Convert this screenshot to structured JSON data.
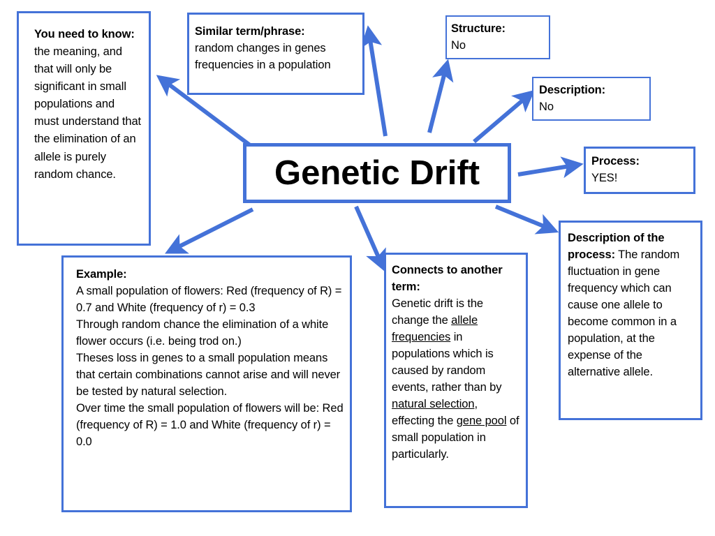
{
  "diagram": {
    "title": "Genetic Drift",
    "type": "concept-map",
    "colors": {
      "border": "#4472D8",
      "arrow": "#4472D8",
      "text": "#000000",
      "background": "#FFFFFF"
    },
    "center": {
      "label": "Genetic Drift"
    },
    "nodes": {
      "need_to_know": {
        "title": "You need to know:",
        "body": " the meaning, and that will only be significant in small populations and must understand that the elimination of an allele is purely random chance."
      },
      "similar_term": {
        "title": "Similar term/phrase:",
        "body": "random changes in genes frequencies in a population"
      },
      "structure": {
        "title": "Structure:",
        "body": "No"
      },
      "description": {
        "title": "Description:",
        "body": "No"
      },
      "process": {
        "title": "Process:",
        "body": "YES!"
      },
      "description_of_process": {
        "title": "Description of the process:",
        "body": " The random fluctuation in gene frequency which can cause one allele to become common in a population, at the expense of the alternative allele."
      },
      "example": {
        "title": "Example:",
        "lines": [
          "A small population of flowers: Red (frequency of R) = 0.7 and White (frequency of r) = 0.3",
          "Through random chance the elimination of a white flower occurs (i.e. being trod on.)",
          "Theses loss in genes to a small population means that certain combinations cannot arise and will never be tested by natural selection.",
          "Over time the small population of flowers will be:  Red (frequency of R) = 1.0 and White (frequency of r) = 0.0"
        ]
      },
      "connects_to": {
        "title": "Connects to another term:",
        "segments": [
          {
            "text": "Genetic drift is the change the ",
            "underline": false
          },
          {
            "text": "allele frequencies",
            "underline": true
          },
          {
            "text": " in populations which is caused by random events, rather than by ",
            "underline": false
          },
          {
            "text": "natural selection",
            "underline": true
          },
          {
            "text": ", effecting the ",
            "underline": false
          },
          {
            "text": "gene pool",
            "underline": true
          },
          {
            "text": " of small population in particularly.",
            "underline": false
          }
        ]
      }
    },
    "connections": [
      {
        "from": "center",
        "to": "need_to_know",
        "direction": "up-left"
      },
      {
        "from": "center",
        "to": "similar_term",
        "direction": "up"
      },
      {
        "from": "center",
        "to": "structure",
        "direction": "up-right"
      },
      {
        "from": "center",
        "to": "description",
        "direction": "up-right"
      },
      {
        "from": "center",
        "to": "process",
        "direction": "right"
      },
      {
        "from": "center",
        "to": "description_of_process",
        "direction": "down-right"
      },
      {
        "from": "center",
        "to": "connects_to",
        "direction": "down"
      },
      {
        "from": "center",
        "to": "example",
        "direction": "down-left"
      }
    ]
  }
}
